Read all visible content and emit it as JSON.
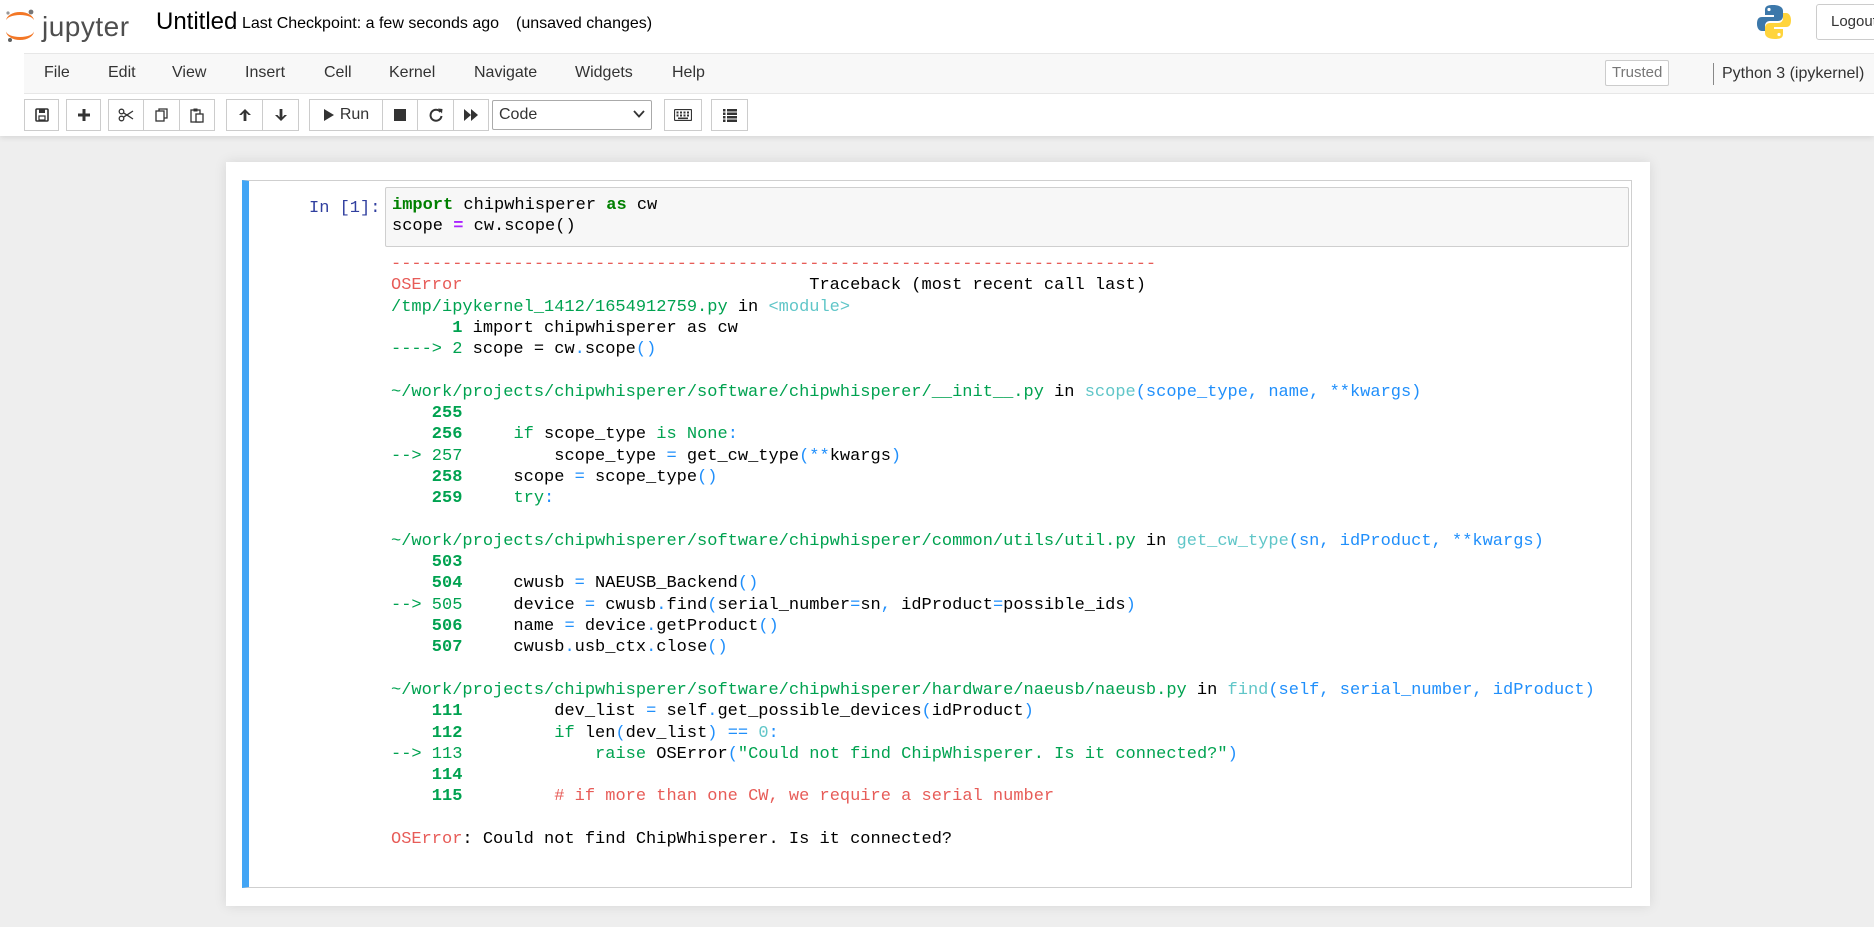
{
  "header": {
    "logo_text": "jupyter",
    "notebook_title": "Untitled",
    "checkpoint": "Last Checkpoint: a few seconds ago",
    "autosave_status": "(unsaved changes)",
    "logout_label": "Logout"
  },
  "menubar": {
    "items": [
      "File",
      "Edit",
      "View",
      "Insert",
      "Cell",
      "Kernel",
      "Navigate",
      "Widgets",
      "Help"
    ],
    "trusted": "Trusted",
    "kernel": "Python 3 (ipykernel)"
  },
  "toolbar": {
    "run_label": "Run",
    "cell_type": "Code"
  },
  "cell": {
    "prompt": "In [1]:",
    "input_lines": [
      [
        "import",
        " chipwhisperer ",
        "as",
        " cw"
      ],
      [
        "scope ",
        "=",
        " cw.scope()"
      ]
    ],
    "traceback": {
      "separator": "---------------------------------------------------------------------------",
      "error_name": "OSError",
      "header_right": "Traceback (most recent call last)",
      "frame1_path": "/tmp/ipykernel_1412/1654912759.py",
      "frame1_in": " in ",
      "frame1_func": "<module>",
      "frame1_l1_num": "      1 ",
      "frame1_l1_code": "import chipwhisperer as cw",
      "frame1_l2_arrow": "----> 2 ",
      "frame1_l2_a": "scope = cw",
      "frame1_l2_b": ".",
      "frame1_l2_c": "scope",
      "frame1_l2_d": "()",
      "frame2_path": "~/work/projects/chipwhisperer/software/chipwhisperer/__init__.py",
      "frame2_in": " in ",
      "frame2_func": "scope",
      "frame2_args": "(scope_type, name, **kwargs)",
      "frame3_path": "~/work/projects/chipwhisperer/software/chipwhisperer/common/utils/util.py",
      "frame3_in": " in ",
      "frame3_func": "get_cw_type",
      "frame3_args": "(sn, idProduct, **kwargs)",
      "frame4_path": "~/work/projects/chipwhisperer/software/chipwhisperer/hardware/naeusb/naeusb.py",
      "frame4_in": " in ",
      "frame4_func": "find",
      "frame4_args": "(self, serial_number, idProduct)",
      "final_error": "OSError",
      "final_message": ": Could not find ChipWhisperer. Is it connected?"
    }
  },
  "colors": {
    "accent_cell_border": "#42a5f5",
    "prompt": "#303f9f",
    "error_red": "#e75c58",
    "green": "#00a250",
    "blue": "#208ffb",
    "cyan": "#60c6c8"
  },
  "icons": [
    "jupyter-logo-icon",
    "python-logo-icon",
    "save-icon",
    "plus-icon",
    "scissors-icon",
    "copy-icon",
    "paste-icon",
    "arrow-up-icon",
    "arrow-down-icon",
    "play-icon",
    "stop-icon",
    "restart-icon",
    "fast-forward-icon",
    "keyboard-icon",
    "list-icon",
    "chevron-down-icon"
  ]
}
